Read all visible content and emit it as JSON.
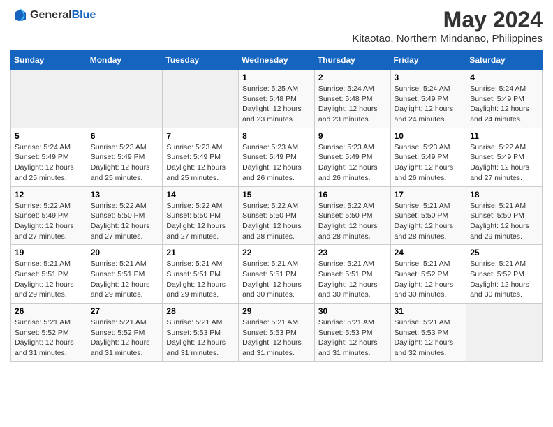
{
  "logo": {
    "text_general": "General",
    "text_blue": "Blue"
  },
  "title": "May 2024",
  "subtitle": "Kitaotao, Northern Mindanao, Philippines",
  "days_of_week": [
    "Sunday",
    "Monday",
    "Tuesday",
    "Wednesday",
    "Thursday",
    "Friday",
    "Saturday"
  ],
  "weeks": [
    [
      {
        "day": "",
        "info": ""
      },
      {
        "day": "",
        "info": ""
      },
      {
        "day": "",
        "info": ""
      },
      {
        "day": "1",
        "info": "Sunrise: 5:25 AM\nSunset: 5:48 PM\nDaylight: 12 hours\nand 23 minutes."
      },
      {
        "day": "2",
        "info": "Sunrise: 5:24 AM\nSunset: 5:48 PM\nDaylight: 12 hours\nand 23 minutes."
      },
      {
        "day": "3",
        "info": "Sunrise: 5:24 AM\nSunset: 5:49 PM\nDaylight: 12 hours\nand 24 minutes."
      },
      {
        "day": "4",
        "info": "Sunrise: 5:24 AM\nSunset: 5:49 PM\nDaylight: 12 hours\nand 24 minutes."
      }
    ],
    [
      {
        "day": "5",
        "info": "Sunrise: 5:24 AM\nSunset: 5:49 PM\nDaylight: 12 hours\nand 25 minutes."
      },
      {
        "day": "6",
        "info": "Sunrise: 5:23 AM\nSunset: 5:49 PM\nDaylight: 12 hours\nand 25 minutes."
      },
      {
        "day": "7",
        "info": "Sunrise: 5:23 AM\nSunset: 5:49 PM\nDaylight: 12 hours\nand 25 minutes."
      },
      {
        "day": "8",
        "info": "Sunrise: 5:23 AM\nSunset: 5:49 PM\nDaylight: 12 hours\nand 26 minutes."
      },
      {
        "day": "9",
        "info": "Sunrise: 5:23 AM\nSunset: 5:49 PM\nDaylight: 12 hours\nand 26 minutes."
      },
      {
        "day": "10",
        "info": "Sunrise: 5:23 AM\nSunset: 5:49 PM\nDaylight: 12 hours\nand 26 minutes."
      },
      {
        "day": "11",
        "info": "Sunrise: 5:22 AM\nSunset: 5:49 PM\nDaylight: 12 hours\nand 27 minutes."
      }
    ],
    [
      {
        "day": "12",
        "info": "Sunrise: 5:22 AM\nSunset: 5:49 PM\nDaylight: 12 hours\nand 27 minutes."
      },
      {
        "day": "13",
        "info": "Sunrise: 5:22 AM\nSunset: 5:50 PM\nDaylight: 12 hours\nand 27 minutes."
      },
      {
        "day": "14",
        "info": "Sunrise: 5:22 AM\nSunset: 5:50 PM\nDaylight: 12 hours\nand 27 minutes."
      },
      {
        "day": "15",
        "info": "Sunrise: 5:22 AM\nSunset: 5:50 PM\nDaylight: 12 hours\nand 28 minutes."
      },
      {
        "day": "16",
        "info": "Sunrise: 5:22 AM\nSunset: 5:50 PM\nDaylight: 12 hours\nand 28 minutes."
      },
      {
        "day": "17",
        "info": "Sunrise: 5:21 AM\nSunset: 5:50 PM\nDaylight: 12 hours\nand 28 minutes."
      },
      {
        "day": "18",
        "info": "Sunrise: 5:21 AM\nSunset: 5:50 PM\nDaylight: 12 hours\nand 29 minutes."
      }
    ],
    [
      {
        "day": "19",
        "info": "Sunrise: 5:21 AM\nSunset: 5:51 PM\nDaylight: 12 hours\nand 29 minutes."
      },
      {
        "day": "20",
        "info": "Sunrise: 5:21 AM\nSunset: 5:51 PM\nDaylight: 12 hours\nand 29 minutes."
      },
      {
        "day": "21",
        "info": "Sunrise: 5:21 AM\nSunset: 5:51 PM\nDaylight: 12 hours\nand 29 minutes."
      },
      {
        "day": "22",
        "info": "Sunrise: 5:21 AM\nSunset: 5:51 PM\nDaylight: 12 hours\nand 30 minutes."
      },
      {
        "day": "23",
        "info": "Sunrise: 5:21 AM\nSunset: 5:51 PM\nDaylight: 12 hours\nand 30 minutes."
      },
      {
        "day": "24",
        "info": "Sunrise: 5:21 AM\nSunset: 5:52 PM\nDaylight: 12 hours\nand 30 minutes."
      },
      {
        "day": "25",
        "info": "Sunrise: 5:21 AM\nSunset: 5:52 PM\nDaylight: 12 hours\nand 30 minutes."
      }
    ],
    [
      {
        "day": "26",
        "info": "Sunrise: 5:21 AM\nSunset: 5:52 PM\nDaylight: 12 hours\nand 31 minutes."
      },
      {
        "day": "27",
        "info": "Sunrise: 5:21 AM\nSunset: 5:52 PM\nDaylight: 12 hours\nand 31 minutes."
      },
      {
        "day": "28",
        "info": "Sunrise: 5:21 AM\nSunset: 5:53 PM\nDaylight: 12 hours\nand 31 minutes."
      },
      {
        "day": "29",
        "info": "Sunrise: 5:21 AM\nSunset: 5:53 PM\nDaylight: 12 hours\nand 31 minutes."
      },
      {
        "day": "30",
        "info": "Sunrise: 5:21 AM\nSunset: 5:53 PM\nDaylight: 12 hours\nand 31 minutes."
      },
      {
        "day": "31",
        "info": "Sunrise: 5:21 AM\nSunset: 5:53 PM\nDaylight: 12 hours\nand 32 minutes."
      },
      {
        "day": "",
        "info": ""
      }
    ]
  ]
}
